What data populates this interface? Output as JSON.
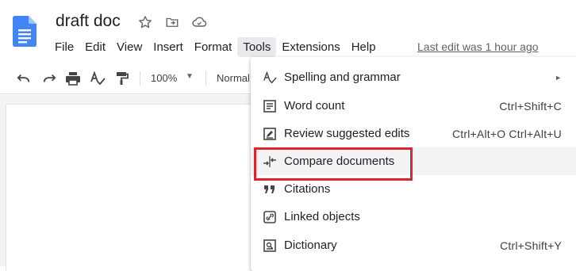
{
  "document": {
    "title": "draft doc",
    "icons": [
      "star-icon",
      "move-to-folder-icon",
      "cloud-status-icon"
    ]
  },
  "menubar": {
    "items": [
      "File",
      "Edit",
      "View",
      "Insert",
      "Format",
      "Tools",
      "Extensions",
      "Help"
    ],
    "active_item": "Tools",
    "last_edit": "Last edit was 1 hour ago"
  },
  "toolbar": {
    "zoom": "100%",
    "style": "Normal",
    "icons": [
      "undo-icon",
      "redo-icon",
      "print-icon",
      "spellcheck-icon",
      "paint-format-icon",
      "dropdown-caret-icon"
    ]
  },
  "tools_menu": {
    "items": [
      {
        "label": "Spelling and grammar",
        "shortcut": "",
        "submenu": true,
        "icon": "spellcheck-icon"
      },
      {
        "label": "Word count",
        "shortcut": "Ctrl+Shift+C",
        "submenu": false,
        "icon": "word-count-icon"
      },
      {
        "label": "Review suggested edits",
        "shortcut": "Ctrl+Alt+O Ctrl+Alt+U",
        "submenu": false,
        "icon": "review-edits-icon"
      },
      {
        "label": "Compare documents",
        "shortcut": "",
        "submenu": false,
        "icon": "compare-icon"
      },
      {
        "label": "Citations",
        "shortcut": "",
        "submenu": false,
        "icon": "quote-icon"
      },
      {
        "label": "Linked objects",
        "shortcut": "",
        "submenu": false,
        "icon": "link-icon"
      },
      {
        "label": "Dictionary",
        "shortcut": "Ctrl+Shift+Y",
        "submenu": false,
        "icon": "dictionary-icon"
      }
    ],
    "highlighted_item": "Compare documents"
  },
  "colors": {
    "doc_blue": "#4285f4",
    "highlight_box": "#d9252b",
    "menu_active_bg": "#e8eaed"
  }
}
